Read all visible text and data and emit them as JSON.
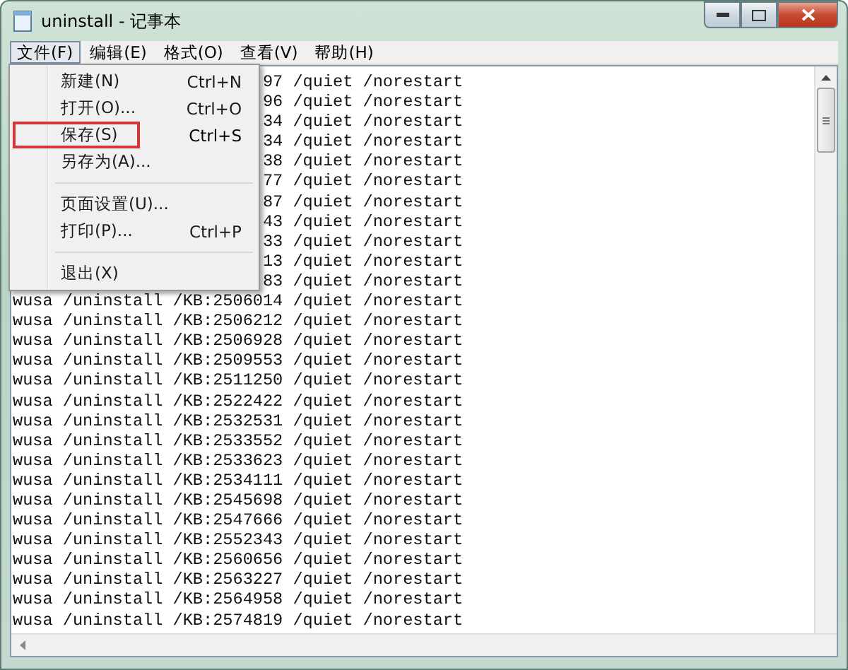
{
  "window": {
    "title": "uninstall - 记事本"
  },
  "menu_bar": [
    {
      "label": "文件(F)",
      "selected": true
    },
    {
      "label": "编辑(E)",
      "selected": false
    },
    {
      "label": "格式(O)",
      "selected": false
    },
    {
      "label": "查看(V)",
      "selected": false
    },
    {
      "label": "帮助(H)",
      "selected": false
    }
  ],
  "file_menu": [
    {
      "kind": "item",
      "label": "新建(N)",
      "shortcut": "Ctrl+N",
      "highlighted": false
    },
    {
      "kind": "item",
      "label": "打开(O)...",
      "shortcut": "Ctrl+O",
      "highlighted": false
    },
    {
      "kind": "item",
      "label": "保存(S)",
      "shortcut": "Ctrl+S",
      "highlighted": true
    },
    {
      "kind": "item",
      "label": "另存为(A)...",
      "highlighted": false
    },
    {
      "kind": "separator"
    },
    {
      "kind": "item",
      "label": "页面设置(U)...",
      "highlighted": false
    },
    {
      "kind": "item",
      "label": "打印(P)...",
      "shortcut": "Ctrl+P",
      "highlighted": false
    },
    {
      "kind": "separator"
    },
    {
      "kind": "item",
      "label": "退出(X)",
      "highlighted": false
    }
  ],
  "text_lines": [
    {
      "kind": "partial",
      "text": "97 /quiet /norestart"
    },
    {
      "kind": "partial",
      "text": "96 /quiet /norestart"
    },
    {
      "kind": "partial",
      "text": "34 /quiet /norestart"
    },
    {
      "kind": "partial",
      "text": "34 /quiet /norestart"
    },
    {
      "kind": "partial",
      "text": "38 /quiet /norestart"
    },
    {
      "kind": "partial",
      "text": "77 /quiet /norestart"
    },
    {
      "kind": "partial",
      "text": "87 /quiet /norestart"
    },
    {
      "kind": "partial",
      "text": "43 /quiet /norestart"
    },
    {
      "kind": "partial",
      "text": "33 /quiet /norestart"
    },
    {
      "kind": "partial",
      "text": "13 /quiet /norestart"
    },
    {
      "kind": "partial",
      "text": "83 /quiet /norestart"
    },
    {
      "kind": "full",
      "text": "wusa /uninstall /KB:2506014 /quiet /norestart"
    },
    {
      "kind": "full",
      "text": "wusa /uninstall /KB:2506212 /quiet /norestart"
    },
    {
      "kind": "full",
      "text": "wusa /uninstall /KB:2506928 /quiet /norestart"
    },
    {
      "kind": "full",
      "text": "wusa /uninstall /KB:2509553 /quiet /norestart"
    },
    {
      "kind": "full",
      "text": "wusa /uninstall /KB:2511250 /quiet /norestart"
    },
    {
      "kind": "full",
      "text": "wusa /uninstall /KB:2522422 /quiet /norestart"
    },
    {
      "kind": "full",
      "text": "wusa /uninstall /KB:2532531 /quiet /norestart"
    },
    {
      "kind": "full",
      "text": "wusa /uninstall /KB:2533552 /quiet /norestart"
    },
    {
      "kind": "full",
      "text": "wusa /uninstall /KB:2533623 /quiet /norestart"
    },
    {
      "kind": "full",
      "text": "wusa /uninstall /KB:2534111 /quiet /norestart"
    },
    {
      "kind": "full",
      "text": "wusa /uninstall /KB:2545698 /quiet /norestart"
    },
    {
      "kind": "full",
      "text": "wusa /uninstall /KB:2547666 /quiet /norestart"
    },
    {
      "kind": "full",
      "text": "wusa /uninstall /KB:2552343 /quiet /norestart"
    },
    {
      "kind": "full",
      "text": "wusa /uninstall /KB:2560656 /quiet /norestart"
    },
    {
      "kind": "full",
      "text": "wusa /uninstall /KB:2563227 /quiet /norestart"
    },
    {
      "kind": "full",
      "text": "wusa /uninstall /KB:2564958 /quiet /norestart"
    },
    {
      "kind": "full",
      "text": "wusa /uninstall /KB:2574819 /quiet /norestart"
    }
  ]
}
